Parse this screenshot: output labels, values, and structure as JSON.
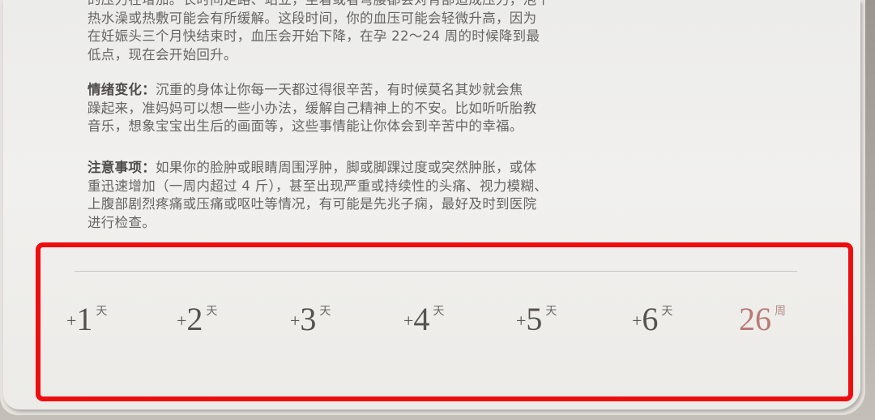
{
  "paragraphs": {
    "p0": [
      "的压力在增加。长时间走路、站立，坐着或者弯腰都会对背部造成压力，泡个",
      "热水澡或热敷可能会有所缓解。这段时间，你的血压可能会轻微升高，因为",
      "在妊娠头三个月快结束时，血压会开始下降，在孕 22～24 周的时候降到最",
      "低点，现在会开始回升。"
    ],
    "p1": {
      "label": "情绪变化：",
      "lines": [
        "沉重的身体让你每一天都过得很辛苦，有时候莫名其妙就会焦",
        "躁起来，准妈妈可以想一些小办法，缓解自己精神上的不安。比如听听胎教",
        "音乐，想象宝宝出生后的画面等，这些事情能让你体会到辛苦中的幸福。"
      ]
    },
    "p2": {
      "label": "注意事项：",
      "lines": [
        "如果你的脸肿或眼睛周围浮肿，脚或脚踝过度或突然肿胀，或体",
        "重迅速增加（一周内超过 4 斤），甚至出现严重或持续性的头痛、视力模糊、",
        "上腹部剧烈疼痛或压痛或呕吐等情况，有可能是先兆子痫，最好及时到医院",
        "进行检查。"
      ]
    }
  },
  "days": [
    {
      "plus": "+",
      "num": "1",
      "unit": "天"
    },
    {
      "plus": "+",
      "num": "2",
      "unit": "天"
    },
    {
      "plus": "+",
      "num": "3",
      "unit": "天"
    },
    {
      "plus": "+",
      "num": "4",
      "unit": "天"
    },
    {
      "plus": "+",
      "num": "5",
      "unit": "天"
    },
    {
      "plus": "+",
      "num": "6",
      "unit": "天"
    }
  ],
  "week": {
    "num": "26",
    "unit": "周"
  },
  "colors": {
    "highlight": "#ee0e10",
    "week_accent": "#b97a74",
    "body_text": "#676563"
  }
}
